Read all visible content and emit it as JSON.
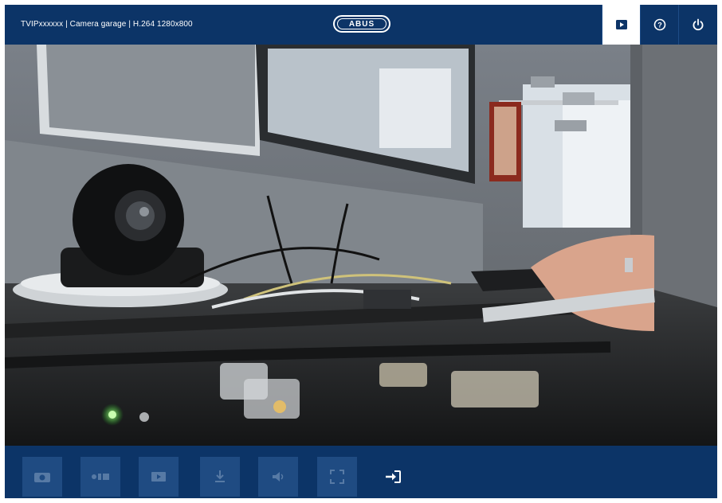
{
  "header": {
    "camera_title": "TVIPxxxxxx | Camera garage | H.264 1280x800",
    "logo_text": "ABUS",
    "buttons": [
      {
        "name": "live-view",
        "icon": "play-icon",
        "active": true
      },
      {
        "name": "help",
        "icon": "help-circle-icon",
        "active": false
      },
      {
        "name": "logout",
        "icon": "power-icon",
        "active": false
      }
    ]
  },
  "video": {
    "content": "live camera stream"
  },
  "toolbar": {
    "buttons": [
      {
        "name": "snapshot",
        "icon": "camera-icon",
        "enabled": false
      },
      {
        "name": "record",
        "icon": "record-icon",
        "enabled": false
      },
      {
        "name": "playback",
        "icon": "playback-icon",
        "enabled": false
      },
      {
        "name": "download",
        "icon": "download-icon",
        "enabled": false
      },
      {
        "name": "audio",
        "icon": "speaker-icon",
        "enabled": false
      },
      {
        "name": "fullscreen",
        "icon": "fullscreen-icon",
        "enabled": false
      },
      {
        "name": "login",
        "icon": "login-icon",
        "enabled": true
      }
    ]
  },
  "colors": {
    "brand_navy": "#0c3467",
    "button_disabled": "#1f4b82",
    "header_text": "#ffffff",
    "active_button_bg": "#ffffff"
  }
}
